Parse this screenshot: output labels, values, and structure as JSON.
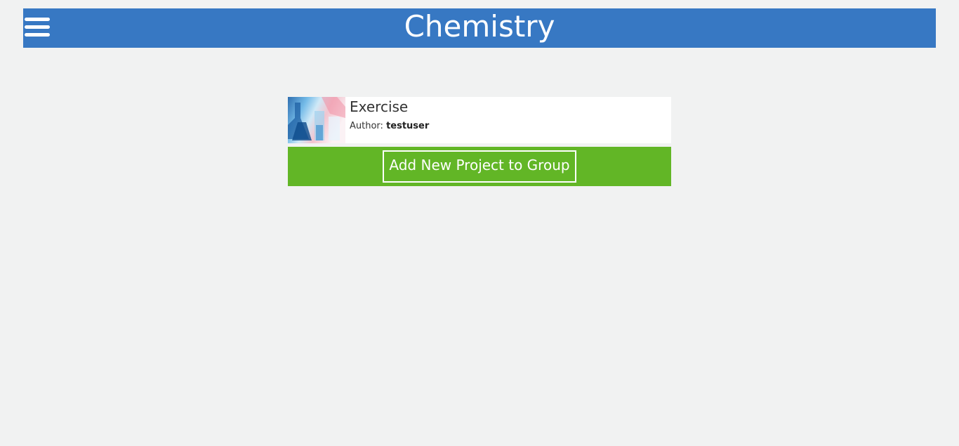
{
  "header": {
    "title": "Chemistry",
    "menu_icon": "hamburger-menu-icon",
    "background_color": "#3778c3"
  },
  "projects": [
    {
      "name": "Exercise",
      "author_label": "Author:",
      "author": "testuser",
      "thumbnail": "chemistry-lab-glassware-image"
    }
  ],
  "actions": {
    "add_project_label": "Add New Project to Group",
    "bar_color": "#62b626"
  }
}
